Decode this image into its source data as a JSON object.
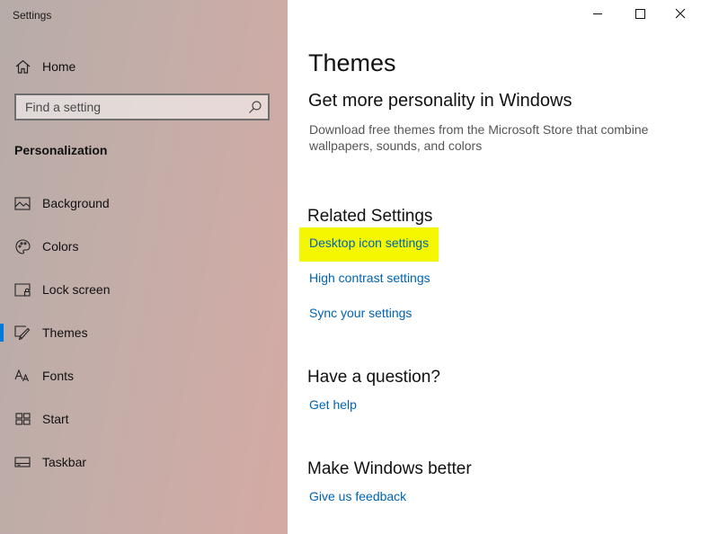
{
  "window": {
    "title": "Settings",
    "controls": [
      "minimize",
      "maximize",
      "close"
    ]
  },
  "sidebar": {
    "home_label": "Home",
    "search_placeholder": "Find a setting",
    "section": "Personalization",
    "items": [
      {
        "label": "Background",
        "icon": "picture-icon"
      },
      {
        "label": "Colors",
        "icon": "palette-icon"
      },
      {
        "label": "Lock screen",
        "icon": "lock-screen-icon"
      },
      {
        "label": "Themes",
        "icon": "themes-brush-icon",
        "selected": true
      },
      {
        "label": "Fonts",
        "icon": "fonts-icon"
      },
      {
        "label": "Start",
        "icon": "start-grid-icon"
      },
      {
        "label": "Taskbar",
        "icon": "taskbar-icon"
      }
    ]
  },
  "main": {
    "title": "Themes",
    "store_heading": "Get more personality in Windows",
    "store_description": "Download free themes from the Microsoft Store that combine wallpapers, sounds, and colors",
    "related_heading": "Related Settings",
    "related_links": [
      "Desktop icon settings",
      "High contrast settings",
      "Sync your settings"
    ],
    "question_heading": "Have a question?",
    "help_link": "Get help",
    "better_heading": "Make Windows better",
    "feedback_link": "Give us feedback"
  },
  "colors": {
    "accent": "#0078d7",
    "link": "#0063b1",
    "highlight": "#f4f700"
  }
}
